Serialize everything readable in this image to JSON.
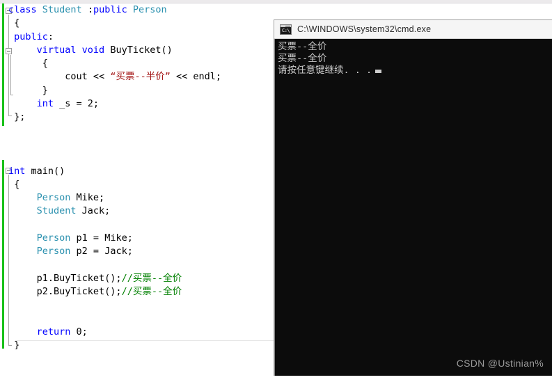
{
  "editor": {
    "name": "code-editor",
    "language": "C++",
    "change_bar_color": "#18c018",
    "colors": {
      "keyword": "#0000ff",
      "type": "#2b91af",
      "string": "#a31515",
      "comment": "#008000",
      "text": "#000000"
    },
    "lines": [
      {
        "n": 1,
        "segments": [
          {
            "t": "class ",
            "c": "kw"
          },
          {
            "t": "Student ",
            "c": "typ"
          },
          {
            "t": ":",
            "c": "plain"
          },
          {
            "t": "public ",
            "c": "kw"
          },
          {
            "t": "Person",
            "c": "typ"
          }
        ]
      },
      {
        "n": 2,
        "segments": [
          {
            "t": " {",
            "c": "plain"
          }
        ]
      },
      {
        "n": 3,
        "segments": [
          {
            "t": " public",
            "c": "kw"
          },
          {
            "t": ":",
            "c": "plain"
          }
        ]
      },
      {
        "n": 4,
        "segments": [
          {
            "t": "     ",
            "c": "plain"
          },
          {
            "t": "virtual ",
            "c": "kw"
          },
          {
            "t": "void ",
            "c": "kw"
          },
          {
            "t": "BuyTicket()",
            "c": "plain"
          }
        ]
      },
      {
        "n": 5,
        "segments": [
          {
            "t": "      {",
            "c": "plain"
          }
        ]
      },
      {
        "n": 6,
        "segments": [
          {
            "t": "          cout << ",
            "c": "plain"
          },
          {
            "t": "“买票--半价”",
            "c": "str"
          },
          {
            "t": " << endl;",
            "c": "plain"
          }
        ]
      },
      {
        "n": 7,
        "segments": [
          {
            "t": "      }",
            "c": "plain"
          }
        ]
      },
      {
        "n": 8,
        "segments": [
          {
            "t": "     ",
            "c": "plain"
          },
          {
            "t": "int ",
            "c": "kw"
          },
          {
            "t": "_s = 2;",
            "c": "plain"
          }
        ]
      },
      {
        "n": 9,
        "segments": [
          {
            "t": " };",
            "c": "plain"
          }
        ]
      },
      {
        "n": 10,
        "segments": [
          {
            "t": "",
            "c": "plain"
          }
        ]
      },
      {
        "n": 11,
        "segments": [
          {
            "t": "",
            "c": "plain"
          }
        ]
      },
      {
        "n": 12,
        "segments": [
          {
            "t": "",
            "c": "plain"
          }
        ]
      },
      {
        "n": 13,
        "segments": [
          {
            "t": "int ",
            "c": "kw"
          },
          {
            "t": "main()",
            "c": "plain"
          }
        ]
      },
      {
        "n": 14,
        "segments": [
          {
            "t": " {",
            "c": "plain"
          }
        ]
      },
      {
        "n": 15,
        "segments": [
          {
            "t": "     ",
            "c": "plain"
          },
          {
            "t": "Person",
            "c": "typ"
          },
          {
            "t": " Mike;",
            "c": "plain"
          }
        ]
      },
      {
        "n": 16,
        "segments": [
          {
            "t": "     ",
            "c": "plain"
          },
          {
            "t": "Student",
            "c": "typ"
          },
          {
            "t": " Jack;",
            "c": "plain"
          }
        ]
      },
      {
        "n": 17,
        "segments": [
          {
            "t": "",
            "c": "plain"
          }
        ]
      },
      {
        "n": 18,
        "segments": [
          {
            "t": "     ",
            "c": "plain"
          },
          {
            "t": "Person",
            "c": "typ"
          },
          {
            "t": " p1 = Mike;",
            "c": "plain"
          }
        ]
      },
      {
        "n": 19,
        "segments": [
          {
            "t": "     ",
            "c": "plain"
          },
          {
            "t": "Person",
            "c": "typ"
          },
          {
            "t": " p2 = Jack;",
            "c": "plain"
          }
        ]
      },
      {
        "n": 20,
        "segments": [
          {
            "t": "",
            "c": "plain"
          }
        ]
      },
      {
        "n": 21,
        "segments": [
          {
            "t": "     p1.BuyTicket();",
            "c": "plain"
          },
          {
            "t": "//买票--全价",
            "c": "cmt"
          }
        ]
      },
      {
        "n": 22,
        "segments": [
          {
            "t": "     p2.BuyTicket();",
            "c": "plain"
          },
          {
            "t": "//买票--全价",
            "c": "cmt"
          }
        ]
      },
      {
        "n": 23,
        "segments": [
          {
            "t": "",
            "c": "plain"
          }
        ]
      },
      {
        "n": 24,
        "segments": [
          {
            "t": "",
            "c": "plain"
          }
        ]
      },
      {
        "n": 25,
        "segments": [
          {
            "t": "     ",
            "c": "plain"
          },
          {
            "t": "return ",
            "c": "kw"
          },
          {
            "t": "0;",
            "c": "plain"
          }
        ]
      },
      {
        "n": 26,
        "segments": [
          {
            "t": " }",
            "c": "plain"
          }
        ]
      }
    ]
  },
  "console": {
    "title": "C:\\WINDOWS\\system32\\cmd.exe",
    "icon": "cmd-icon",
    "icon_prompt": "C:\\",
    "background": "#0c0c0c",
    "foreground": "#cccccc",
    "output": [
      "买票--全价",
      "买票--全价",
      "请按任意键继续. . ."
    ]
  },
  "watermark": {
    "text": "CSDN @Ustinian%"
  }
}
